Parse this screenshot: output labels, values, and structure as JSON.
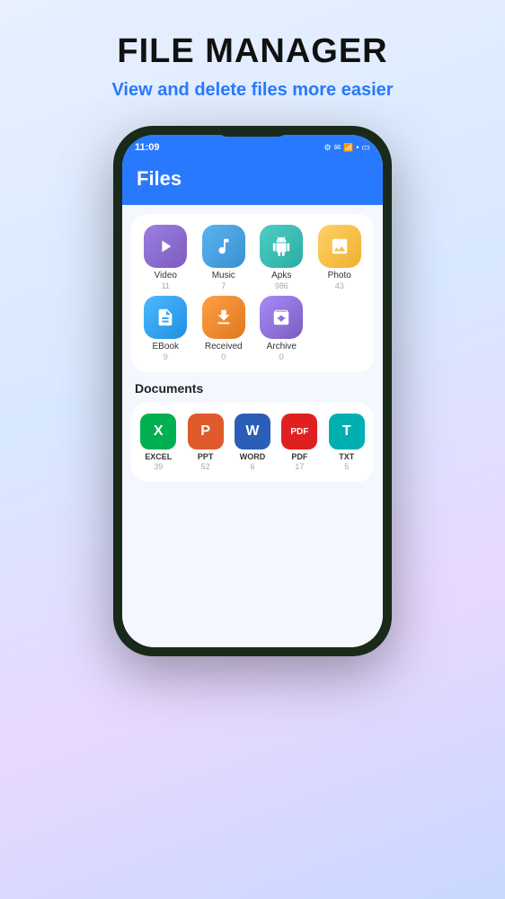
{
  "page": {
    "title": "FILE MANAGER",
    "subtitle": "View and delete files more easier"
  },
  "phone": {
    "status_bar": {
      "time": "11:09",
      "battery_icon": "🔋"
    },
    "header": {
      "title": "Files"
    },
    "file_categories": [
      {
        "name": "Video",
        "count": "11",
        "icon": "▶",
        "color_class": "icon-video"
      },
      {
        "name": "Music",
        "count": "7",
        "icon": "♪",
        "color_class": "icon-music"
      },
      {
        "name": "Apks",
        "count": "986",
        "icon": "🤖",
        "color_class": "icon-apks"
      },
      {
        "name": "Photo",
        "count": "43",
        "icon": "🖼",
        "color_class": "icon-photo"
      },
      {
        "name": "EBook",
        "count": "9",
        "icon": "📋",
        "color_class": "icon-ebook"
      },
      {
        "name": "Received",
        "count": "0",
        "icon": "📥",
        "color_class": "icon-received"
      },
      {
        "name": "Archive",
        "count": "0",
        "icon": "🗜",
        "color_class": "icon-archive"
      }
    ],
    "documents_section": {
      "title": "Documents",
      "items": [
        {
          "name": "EXCEL",
          "count": "39",
          "letter": "X",
          "color_class": "icon-excel"
        },
        {
          "name": "PPT",
          "count": "52",
          "letter": "P",
          "color_class": "icon-ppt"
        },
        {
          "name": "WORD",
          "count": "6",
          "letter": "W",
          "color_class": "icon-word"
        },
        {
          "name": "PDF",
          "count": "17",
          "letter": "PDF",
          "color_class": "icon-pdf"
        },
        {
          "name": "TXT",
          "count": "5",
          "letter": "T",
          "color_class": "icon-txt"
        }
      ]
    }
  }
}
